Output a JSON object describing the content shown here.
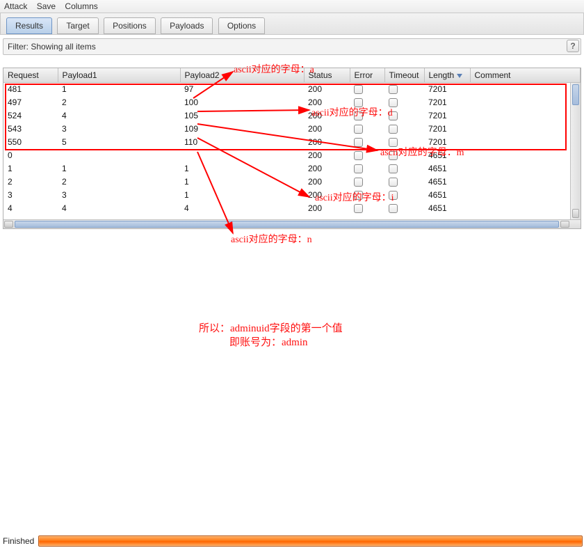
{
  "menu": {
    "attack": "Attack",
    "save": "Save",
    "columns": "Columns"
  },
  "tabs": {
    "results": "Results",
    "target": "Target",
    "positions": "Positions",
    "payloads": "Payloads",
    "options": "Options"
  },
  "filter": {
    "text": "Filter: Showing all items",
    "help": "?"
  },
  "columns": {
    "request": "Request",
    "payload1": "Payload1",
    "payload2": "Payload2",
    "status": "Status",
    "error": "Error",
    "timeout": "Timeout",
    "length": "Length",
    "comment": "Comment"
  },
  "rows": [
    {
      "request": "481",
      "payload1": "1",
      "payload2": "97",
      "status": "200",
      "length": "7201"
    },
    {
      "request": "497",
      "payload1": "2",
      "payload2": "100",
      "status": "200",
      "length": "7201"
    },
    {
      "request": "524",
      "payload1": "4",
      "payload2": "105",
      "status": "200",
      "length": "7201"
    },
    {
      "request": "543",
      "payload1": "3",
      "payload2": "109",
      "status": "200",
      "length": "7201"
    },
    {
      "request": "550",
      "payload1": "5",
      "payload2": "110",
      "status": "200",
      "length": "7201"
    },
    {
      "request": "0",
      "payload1": "",
      "payload2": "",
      "status": "200",
      "length": "4651"
    },
    {
      "request": "1",
      "payload1": "1",
      "payload2": "1",
      "status": "200",
      "length": "4651"
    },
    {
      "request": "2",
      "payload1": "2",
      "payload2": "1",
      "status": "200",
      "length": "4651"
    },
    {
      "request": "3",
      "payload1": "3",
      "payload2": "1",
      "status": "200",
      "length": "4651"
    },
    {
      "request": "4",
      "payload1": "4",
      "payload2": "4",
      "status": "200",
      "length": "4651"
    }
  ],
  "annotations": {
    "a": "ascii对应的字母：a",
    "d": "ascii对应的字母：d",
    "m": "ascii对应的字母：m",
    "i": "ascii对应的字母：i",
    "n": "ascii对应的字母：n",
    "concl1": "所以：adminuid字段的第一个值",
    "concl2": "即账号为：admin"
  },
  "status": {
    "finished": "Finished"
  }
}
